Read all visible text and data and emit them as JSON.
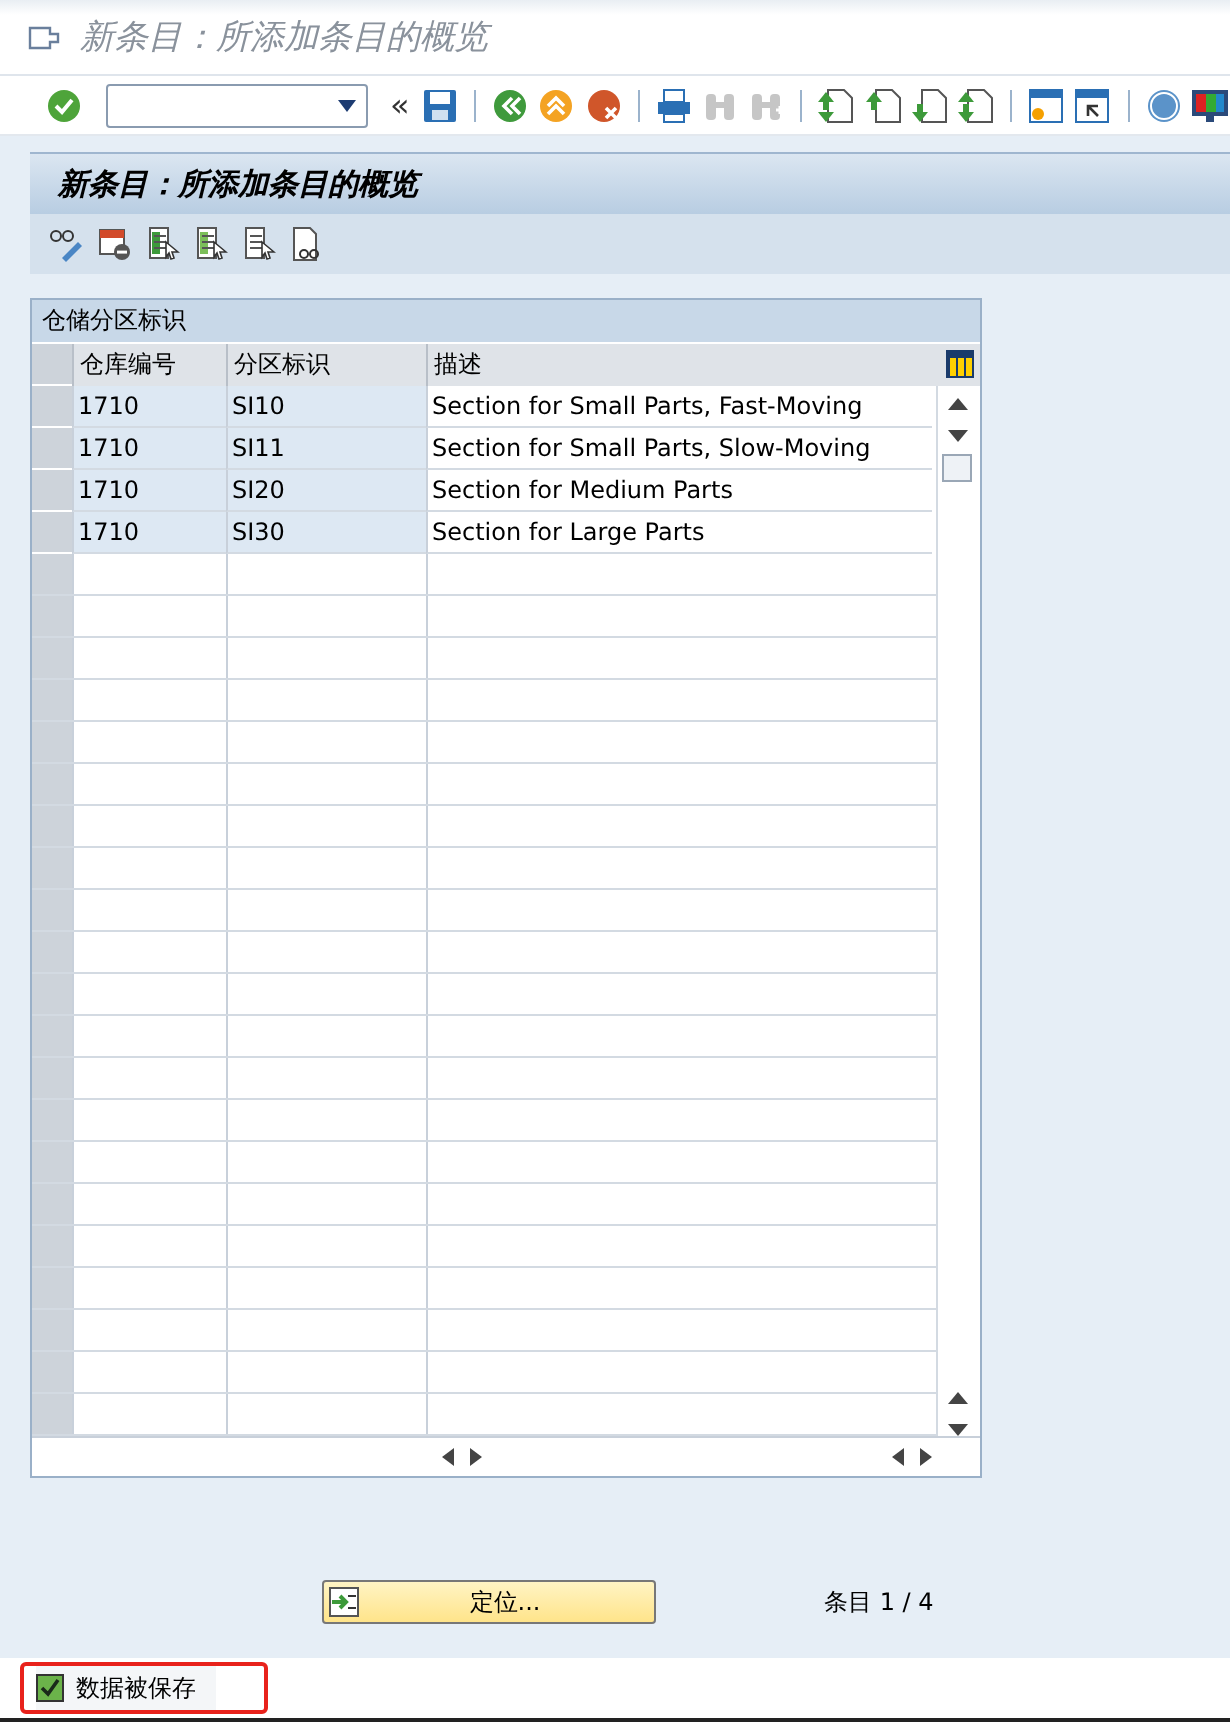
{
  "window": {
    "title": "新条目：所添加条目的概览"
  },
  "toolbar": [
    {
      "kind": "enter",
      "disabled": false
    },
    {
      "kind": "command-field"
    },
    {
      "kind": "text",
      "text": "«"
    },
    {
      "kind": "save",
      "disabled": false
    },
    {
      "kind": "separator"
    },
    {
      "kind": "back",
      "disabled": false
    },
    {
      "kind": "exit",
      "disabled": false
    },
    {
      "kind": "cancel",
      "disabled": false
    },
    {
      "kind": "separator"
    },
    {
      "kind": "print",
      "disabled": false
    },
    {
      "kind": "find",
      "disabled": true
    },
    {
      "kind": "find-next",
      "disabled": true
    },
    {
      "kind": "separator"
    },
    {
      "kind": "first-page",
      "disabled": false
    },
    {
      "kind": "prev-page",
      "disabled": false
    },
    {
      "kind": "next-page",
      "disabled": false
    },
    {
      "kind": "last-page",
      "disabled": false
    },
    {
      "kind": "separator"
    },
    {
      "kind": "new-session",
      "disabled": false
    },
    {
      "kind": "shortcut",
      "disabled": false
    },
    {
      "kind": "separator"
    },
    {
      "kind": "help",
      "disabled": false
    },
    {
      "kind": "layout",
      "disabled": false
    }
  ],
  "panel": {
    "title": "新条目：所添加条目的概览"
  },
  "app_toolbar": [
    {
      "kind": "display-change"
    },
    {
      "kind": "delete-row"
    },
    {
      "kind": "select-all"
    },
    {
      "kind": "select-block"
    },
    {
      "kind": "deselect-all"
    },
    {
      "kind": "details"
    }
  ],
  "table": {
    "title": "仓储分区标识",
    "columns": [
      {
        "label": "仓库编号",
        "key": true
      },
      {
        "label": "分区标识",
        "key": true
      },
      {
        "label": "描述",
        "key": false
      }
    ],
    "rows": [
      {
        "cells": [
          "1710",
          "SI10",
          "Section for Small Parts, Fast-Moving"
        ]
      },
      {
        "cells": [
          "1710",
          "SI11",
          "Section for Small Parts, Slow-Moving"
        ]
      },
      {
        "cells": [
          "1710",
          "SI20",
          "Section for Medium Parts"
        ]
      },
      {
        "cells": [
          "1710",
          "SI30",
          "Section for Large Parts"
        ]
      }
    ]
  },
  "position_button": {
    "label": "定位..."
  },
  "entry_count": "条目 1 / 4",
  "status_bar": {
    "kind": "success",
    "text": "数据被保存",
    "highlighted": true
  }
}
